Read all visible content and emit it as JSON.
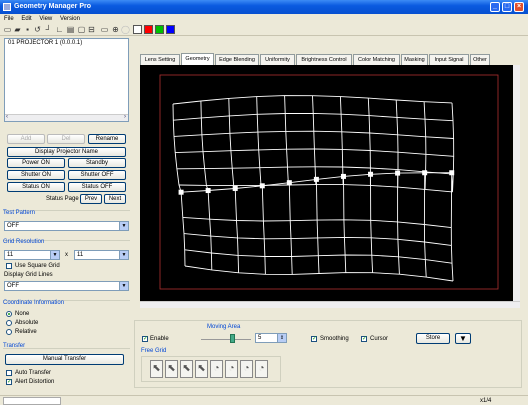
{
  "window": {
    "title": "Geometry Manager Pro"
  },
  "menu": [
    "File",
    "Edit",
    "View",
    "Version"
  ],
  "toolbar": {
    "icons": [
      "new-icon",
      "open-icon",
      "save-icon",
      "undo-icon",
      "line-icon",
      "corner-icon",
      "grid-icon",
      "copy-icon",
      "folder-icon",
      "window-icon",
      "crosshair-icon",
      "circle-icon"
    ],
    "swatches": [
      "#ffffff",
      "#ff0000",
      "#00c000",
      "#0000ff"
    ]
  },
  "projector_list": {
    "items": [
      "01   PROJECTOR 1 (0.0.0.1)"
    ]
  },
  "list_buttons": {
    "add": "Add",
    "del": "Del",
    "rename": "Rename"
  },
  "display_projector_name": "Display Projector Name",
  "power_on": "Power ON",
  "standby": "Standby",
  "shutter_on": "Shutter ON",
  "shutter_off": "Shutter OFF",
  "status_on": "Status ON",
  "status_off": "Status OFF",
  "status_page": {
    "label": "Status Page",
    "prev": "Prev",
    "next": "Next"
  },
  "test_pattern": {
    "label": "Test Pattern",
    "value": "OFF"
  },
  "grid_resolution": {
    "label": "Grid Resolution",
    "x_value": "11",
    "sep": "x",
    "y_value": "11",
    "use_square": "Use Square Grid"
  },
  "display_grid_lines": {
    "label": "Display Grid Lines",
    "value": "OFF"
  },
  "coordinate_info": {
    "label": "Coordinate Information",
    "options": [
      "None",
      "Absolute",
      "Relative"
    ],
    "selected": 0
  },
  "transfer": {
    "label": "Transfer",
    "manual": "Manual Transfer",
    "auto": "Auto Transfer",
    "alert": "Alert Distortion"
  },
  "tabs": [
    "Lens Setting",
    "Geometry",
    "Edge Blending",
    "Uniformity",
    "Brightness Control",
    "Color Matching",
    "Masking",
    "Input Signal",
    "Other"
  ],
  "active_tab": 1,
  "bottom": {
    "enable": "Enable",
    "moving_area": "Moving Area",
    "moving_value": "5",
    "smoothing": "Smoothing",
    "cursor": "Cursor",
    "store": "Store",
    "free_grid": "Free Grid"
  },
  "status": {
    "zoom": "x1/4"
  }
}
